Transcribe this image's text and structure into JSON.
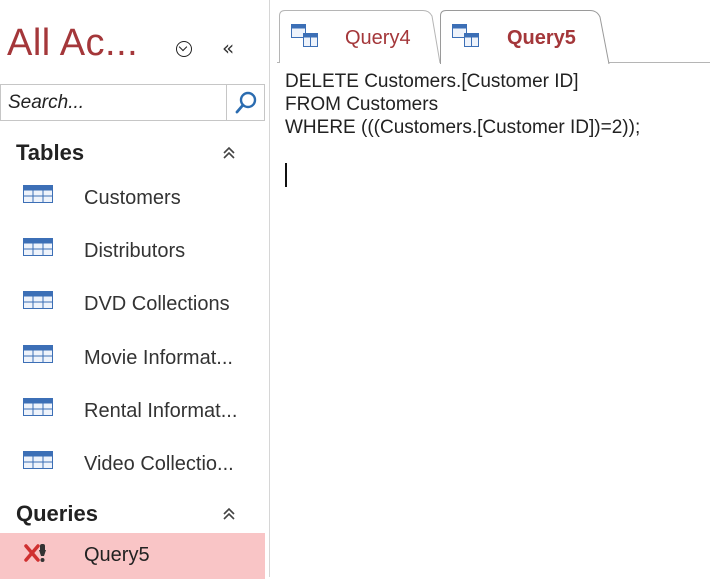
{
  "nav": {
    "title": "All Ac...",
    "search_placeholder": "Search...",
    "groups": {
      "tables": {
        "label": "Tables",
        "items": [
          "Customers",
          "Distributors",
          "DVD Collections",
          "Movie Informat...",
          "Rental Informat...",
          "Video Collectio..."
        ]
      },
      "queries": {
        "label": "Queries",
        "items": [
          "Query5"
        ],
        "selected": "Query5"
      }
    }
  },
  "tabs": [
    {
      "label": "Query4",
      "active": false
    },
    {
      "label": "Query5",
      "active": true
    }
  ],
  "editor": {
    "lines": [
      "DELETE Customers.[Customer ID]",
      "FROM Customers",
      "WHERE (((Customers.[Customer ID])=2));"
    ]
  },
  "colors": {
    "accent": "#a4373a",
    "selected_bg": "#f9c5c6"
  }
}
